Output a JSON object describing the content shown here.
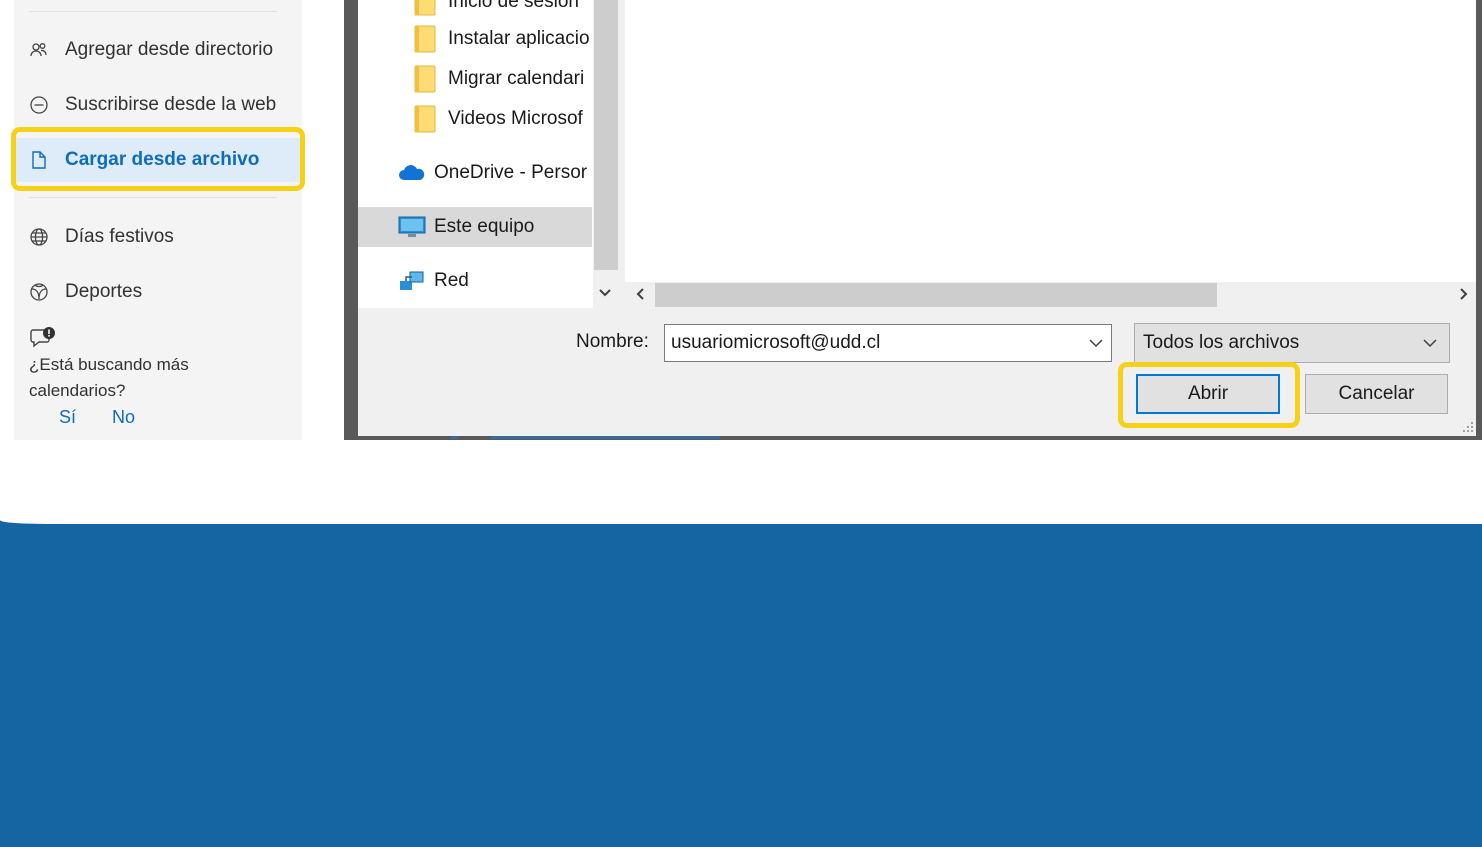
{
  "sidebar": {
    "items": [
      {
        "label": "Agregar desde directorio",
        "icon": "people-add-icon"
      },
      {
        "label": "Suscribirse desde la web",
        "icon": "web-subscribe-icon"
      },
      {
        "label": "Cargar desde archivo",
        "icon": "file-upload-icon",
        "selected": true
      },
      {
        "label": "Días festivos",
        "icon": "globe-icon"
      },
      {
        "label": "Deportes",
        "icon": "sports-ball-icon"
      }
    ],
    "promo": {
      "question": "¿Está buscando más calendarios?",
      "yes": "Sí",
      "no": "No"
    }
  },
  "dialog": {
    "nav": {
      "folders": [
        "Inicio de sesión",
        "Instalar aplicacio",
        "Migrar calendari",
        "Videos Microsof"
      ],
      "onedrive": "OneDrive - Persor",
      "this_pc": "Este equipo",
      "network": "Red"
    },
    "name_label": "Nombre:",
    "name_value": "usuariomicrosoft@udd.cl",
    "file_type": "Todos los archivos",
    "open_button": "Abrir",
    "cancel_button": "Cancelar"
  },
  "colors": {
    "accent": "#0f6cbd",
    "highlight": "#f7d117",
    "band": "#1565a3",
    "selected_bg": "#deecf9"
  }
}
